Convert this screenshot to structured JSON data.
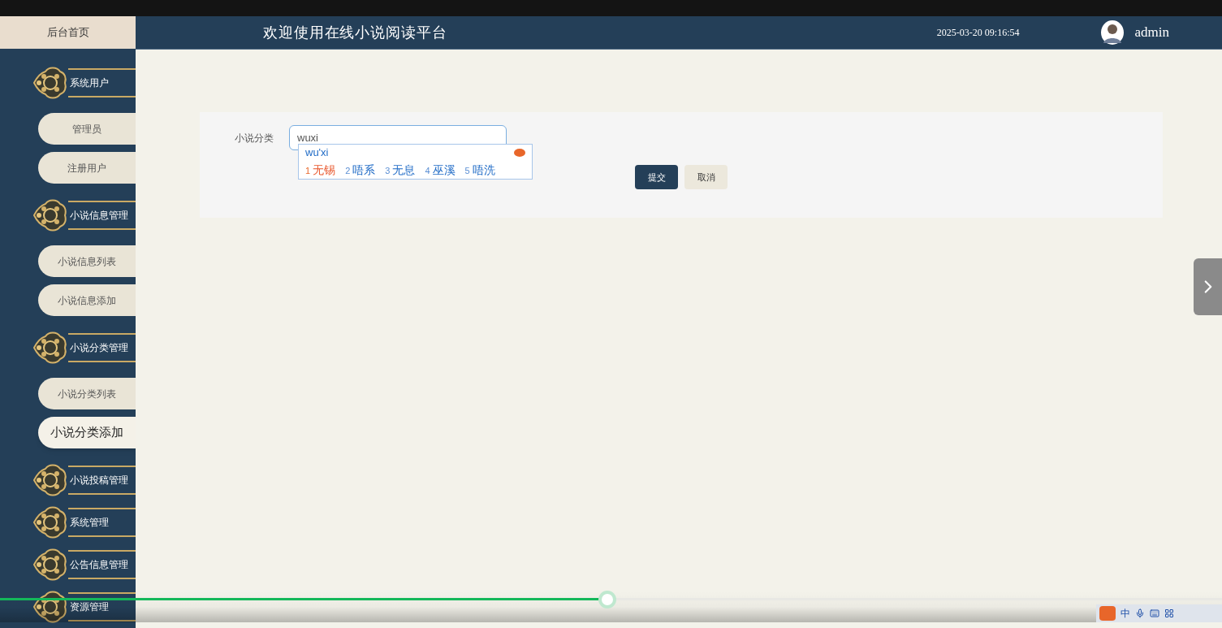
{
  "header": {
    "home": "后台首页",
    "title": "欢迎使用在线小说阅读平台",
    "datetime": "2025-03-20 09:16:54",
    "user": "admin"
  },
  "sidebar": {
    "groups": [
      {
        "label": "系统用户",
        "children": [
          {
            "label": "管理员",
            "selected": false
          },
          {
            "label": "注册用户",
            "selected": false
          }
        ]
      },
      {
        "label": "小说信息管理",
        "children": [
          {
            "label": "小说信息列表",
            "selected": false
          },
          {
            "label": "小说信息添加",
            "selected": false
          }
        ]
      },
      {
        "label": "小说分类管理",
        "children": [
          {
            "label": "小说分类列表",
            "selected": false
          },
          {
            "label": "小说分类添加",
            "selected": true
          }
        ]
      },
      {
        "label": "小说投稿管理"
      },
      {
        "label": "系统管理"
      },
      {
        "label": "公告信息管理"
      },
      {
        "label": "资源管理"
      }
    ]
  },
  "form": {
    "fields": [
      {
        "label": "小说分类",
        "value": "wuxi"
      }
    ],
    "buttons": [
      {
        "label": "提交",
        "kind": "primary"
      },
      {
        "label": "取消",
        "kind": "secondary"
      }
    ]
  },
  "ime": {
    "composition": "wu'xi",
    "candidates": [
      {
        "index": "1",
        "text": "无锡",
        "selected": true
      },
      {
        "index": "2",
        "text": "唔系",
        "selected": false
      },
      {
        "index": "3",
        "text": "无息",
        "selected": false
      },
      {
        "index": "4",
        "text": "巫溪",
        "selected": false
      },
      {
        "index": "5",
        "text": "唔洗",
        "selected": false
      }
    ],
    "status": "中"
  },
  "player": {
    "level": 0.497
  }
}
